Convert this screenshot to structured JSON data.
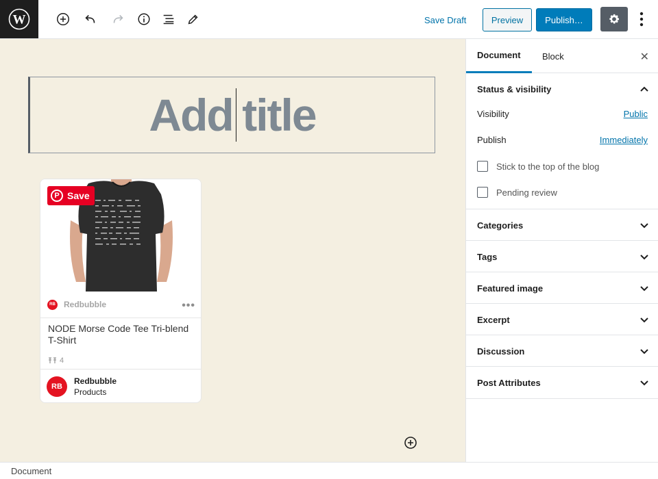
{
  "toolbar": {
    "save_draft_label": "Save Draft",
    "preview_label": "Preview",
    "publish_label": "Publish…"
  },
  "editor": {
    "title_placeholder_left": "Add",
    "title_placeholder_right": "title"
  },
  "pin": {
    "save_label": "Save",
    "source_name": "Redbubble",
    "description": "NODE Morse Code Tee Tri-blend T-Shirt",
    "pin_count": "4",
    "profile_name": "Redbubble",
    "board_name": "Products",
    "logo_text": "RB"
  },
  "sidebar": {
    "tabs": [
      {
        "label": "Document"
      },
      {
        "label": "Block"
      }
    ],
    "status_visibility": {
      "title": "Status & visibility",
      "visibility_label": "Visibility",
      "visibility_value": "Public",
      "publish_label": "Publish",
      "publish_value": "Immediately",
      "sticky_label": "Stick to the top of the blog",
      "pending_label": "Pending review"
    },
    "panels": [
      {
        "title": "Categories"
      },
      {
        "title": "Tags"
      },
      {
        "title": "Featured image"
      },
      {
        "title": "Excerpt"
      },
      {
        "title": "Discussion"
      },
      {
        "title": "Post Attributes"
      }
    ]
  },
  "statusbar": {
    "breadcrumb": "Document"
  },
  "colors": {
    "accent": "#007cba",
    "canvas_bg": "#f4efe1",
    "pinterest_red": "#e60023",
    "redbubble_red": "#e41321"
  }
}
